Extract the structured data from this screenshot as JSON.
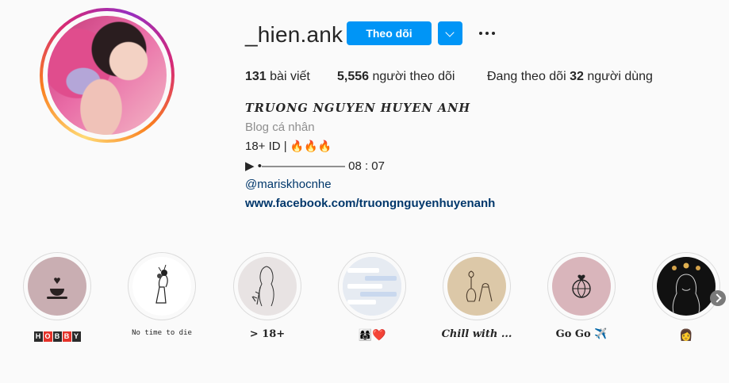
{
  "profile": {
    "username": "_hien.ank",
    "follow_label": "Theo dõi",
    "posts_count": "131",
    "posts_label": "bài viết",
    "followers_count": "5,556",
    "followers_label": "người theo dõi",
    "following_prefix": "Đang theo dõi",
    "following_count": "32",
    "following_label": "người dùng",
    "full_name": "TRUONG NGUYEN HUYEN ANH",
    "category": "Blog cá nhân",
    "bio_line_1": "18+ ID | ",
    "bio_fire": "🔥🔥🔥",
    "bio_line_2": "▶ •——————— 08 : 07",
    "mention": "@mariskhocnhe",
    "website": "www.facebook.com/truongnguyenhuyenanh"
  },
  "highlights": [
    {
      "label": "HOBBY",
      "letters": [
        "H",
        "O",
        "B",
        "B",
        "Y"
      ],
      "colors": [
        "#2b2b2b",
        "#e5332a",
        "#2b2b2b",
        "#e5332a",
        "#2b2b2b"
      ]
    },
    {
      "label": "No time to die"
    },
    {
      "label": "> 18+"
    },
    {
      "label": "👩‍👩‍👧❤️"
    },
    {
      "label": "Chill with ..."
    },
    {
      "label": "Go Go ✈️"
    },
    {
      "label": "👩"
    }
  ],
  "colors": {
    "follow_button": "#0095f6",
    "link": "#00376b",
    "secondary_text": "#8e8e8e",
    "highlight_ring": "#dbdbdb"
  },
  "icons": [
    "chevron-down-icon",
    "more-options-icon",
    "next-arrow-icon"
  ]
}
